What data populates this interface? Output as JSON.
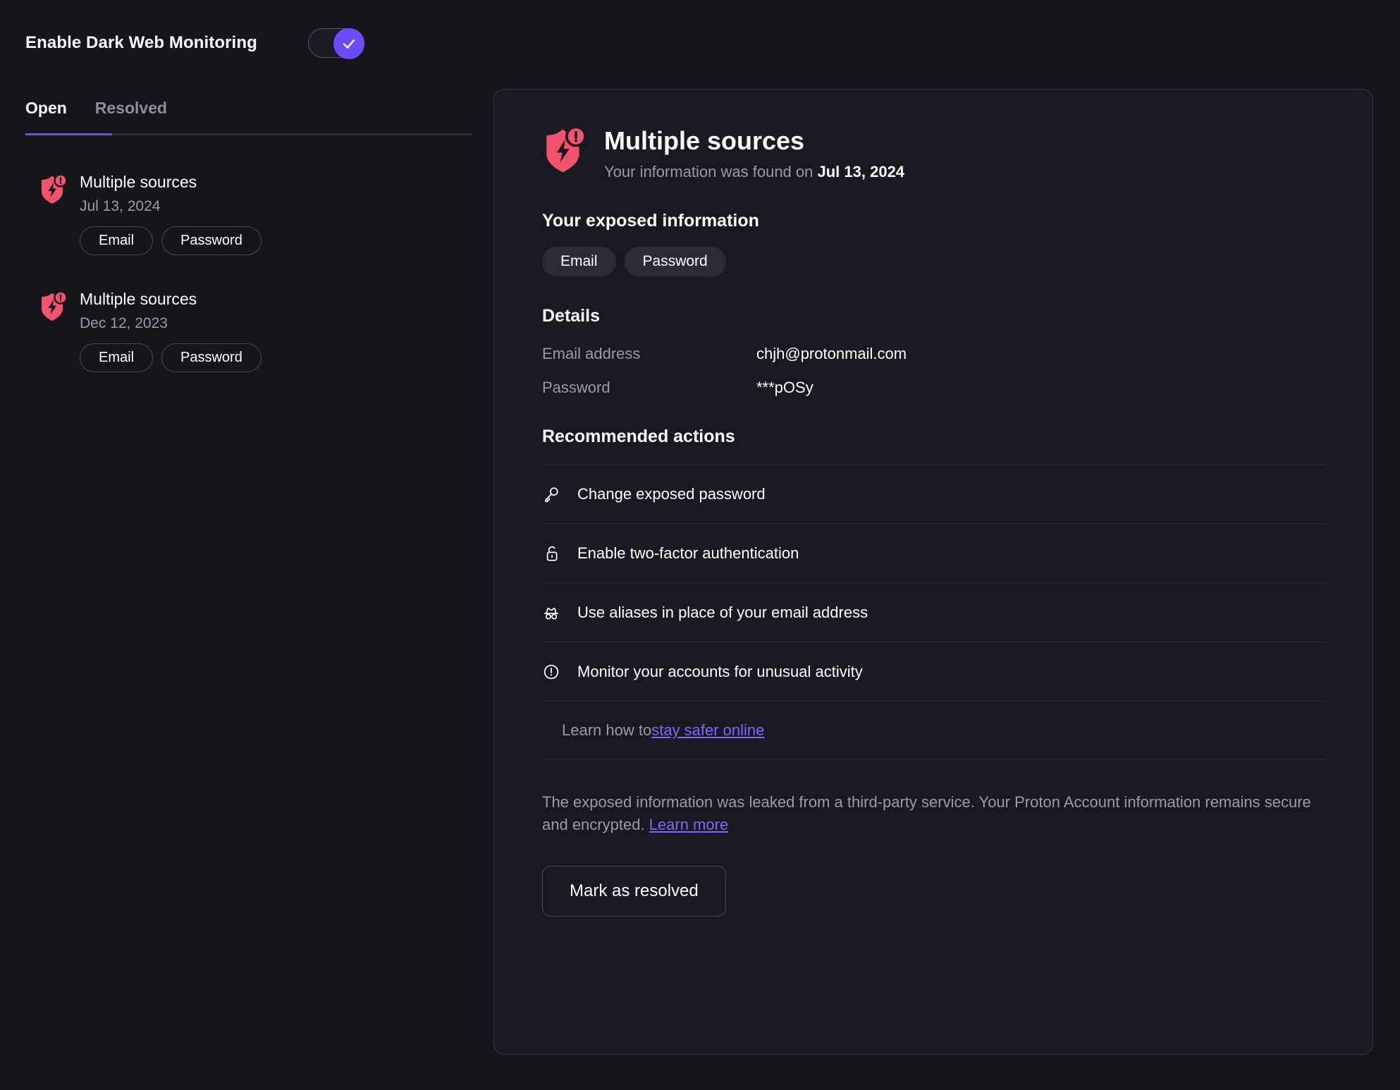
{
  "header": {
    "toggle_label": "Enable Dark Web Monitoring",
    "toggle_state": "on",
    "accent_color": "#6d4aff"
  },
  "tabs": [
    {
      "label": "Open",
      "active": true
    },
    {
      "label": "Resolved",
      "active": false
    }
  ],
  "breach_list": [
    {
      "title": "Multiple sources",
      "date": "Jul 13, 2024",
      "pills": [
        "Email",
        "Password"
      ],
      "icon": "shield-alert-icon"
    },
    {
      "title": "Multiple sources",
      "date": "Dec 12, 2023",
      "pills": [
        "Email",
        "Password"
      ],
      "icon": "shield-alert-icon"
    }
  ],
  "detail": {
    "title": "Multiple sources",
    "subtitle_prefix": "Your information was found on ",
    "subtitle_date": "Jul 13, 2024",
    "exposed_heading": "Your exposed information",
    "exposed_badges": [
      "Email",
      "Password"
    ],
    "details_heading": "Details",
    "details_rows": [
      {
        "label": "Email address",
        "value": "chjh@protonmail.com"
      },
      {
        "label": "Password",
        "value": "***pOSy"
      }
    ],
    "actions_heading": "Recommended actions",
    "actions": [
      {
        "label": "Change exposed password",
        "icon": "key-icon"
      },
      {
        "label": "Enable two-factor authentication",
        "icon": "lock-icon"
      },
      {
        "label": "Use aliases in place of your email address",
        "icon": "incognito-icon"
      },
      {
        "label": "Monitor your accounts for unusual activity",
        "icon": "exclamation-circle-icon"
      }
    ],
    "learn_prefix": "Learn how to ",
    "learn_link": "stay safer online",
    "disclaimer_text": "The exposed information was leaked from a third-party service. Your Proton Account information remains secure and encrypted. ",
    "disclaimer_link": "Learn more",
    "resolve_button": "Mark as resolved",
    "link_color": "#8067ff",
    "breach_color": "#f0536b"
  }
}
